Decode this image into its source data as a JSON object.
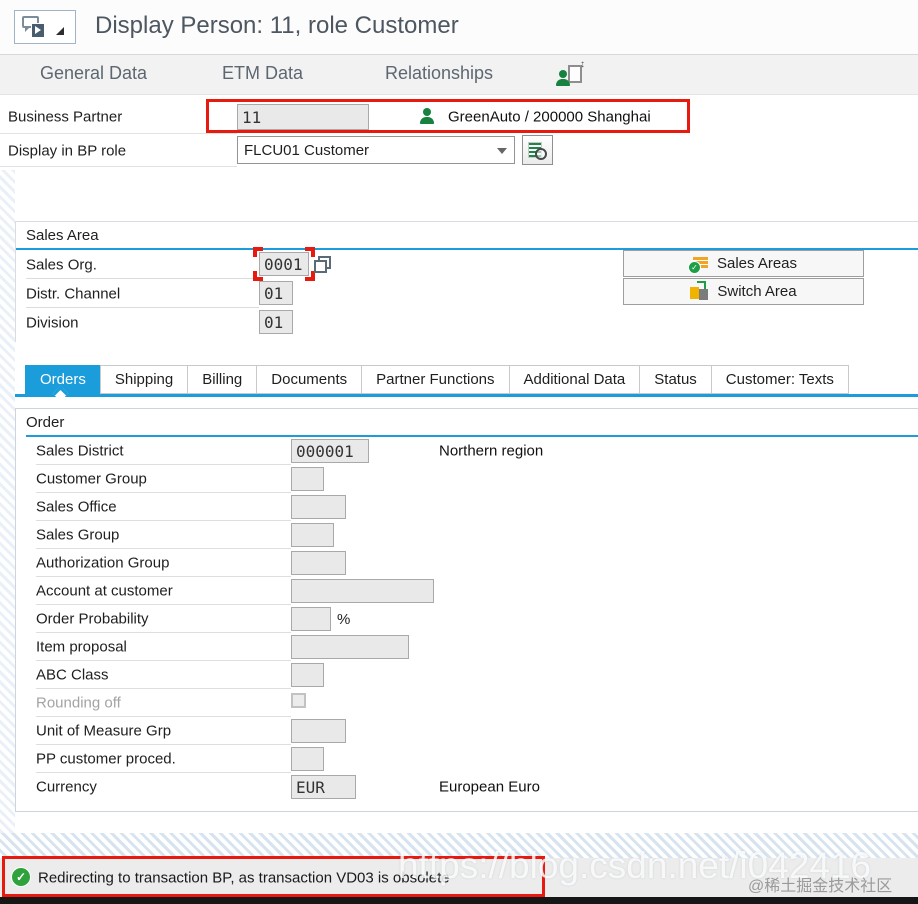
{
  "window": {
    "title": "Display Person: 11, role Customer"
  },
  "nav": {
    "items": [
      {
        "label": "General Data"
      },
      {
        "label": "ETM Data"
      },
      {
        "label": "Relationships"
      }
    ],
    "relationship_icon": "person-sync-icon"
  },
  "bp": {
    "business_partner": {
      "label": "Business Partner",
      "value": "11",
      "icon": "person-icon",
      "description": "GreenAuto / 200000 Shanghai"
    },
    "role": {
      "label": "Display in BP role",
      "value": "FLCU01 Customer",
      "picker_icon": "role-search-icon"
    }
  },
  "sales_area": {
    "title": "Sales Area",
    "fields": [
      {
        "label": "Sales Org.",
        "value": "0001",
        "size": "w50",
        "annotated": true,
        "copy_icon": "multiple-values-icon"
      },
      {
        "label": "Distr. Channel",
        "value": "01",
        "size": "w34"
      },
      {
        "label": "Division",
        "value": "01",
        "size": "w34"
      }
    ],
    "buttons": [
      {
        "label": "Sales Areas",
        "icon": "sales-areas-icon"
      },
      {
        "label": "Switch Area",
        "icon": "switch-area-icon"
      }
    ]
  },
  "tabs": {
    "items": [
      {
        "label": "Orders",
        "active": true
      },
      {
        "label": "Shipping"
      },
      {
        "label": "Billing"
      },
      {
        "label": "Documents"
      },
      {
        "label": "Partner Functions"
      },
      {
        "label": "Additional Data"
      },
      {
        "label": "Status"
      },
      {
        "label": "Customer: Texts"
      }
    ]
  },
  "order": {
    "title": "Order",
    "rows": [
      {
        "label": "Sales District",
        "value": "000001",
        "size": "w78",
        "desc": "Northern region"
      },
      {
        "label": "Customer Group",
        "value": "",
        "size": "w33"
      },
      {
        "label": "Sales Office",
        "value": "",
        "size": "w55"
      },
      {
        "label": "Sales Group",
        "value": "",
        "size": "w43"
      },
      {
        "label": "Authorization Group",
        "value": "",
        "size": "w55"
      },
      {
        "label": "Account at customer",
        "value": "",
        "size": "w143"
      },
      {
        "label": "Order Probability",
        "value": "",
        "size": "w40",
        "suffix": "%"
      },
      {
        "label": "Item proposal",
        "value": "",
        "size": "w118"
      },
      {
        "label": "ABC Class",
        "value": "",
        "size": "w33"
      },
      {
        "label": "Rounding off",
        "type": "checkbox",
        "disabled": true
      },
      {
        "label": "Unit of Measure Grp",
        "value": "",
        "size": "w55"
      },
      {
        "label": "PP customer proced.",
        "value": "",
        "size": "w33"
      },
      {
        "label": "Currency",
        "value": "EUR",
        "size": "w65",
        "desc": "European Euro"
      }
    ]
  },
  "status": {
    "message": "Redirecting to transaction BP, as transaction VD03 is obsolete",
    "icon": "success-icon"
  },
  "watermarks": {
    "url": "https://blog.csdn.net/i042416",
    "community": "@稀土掘金技术社区"
  },
  "colors": {
    "accent_blue": "#1b9ddb",
    "annotation_red": "#e8190f",
    "success_green": "#2fa23c",
    "field_bg": "#e9e9e9"
  }
}
